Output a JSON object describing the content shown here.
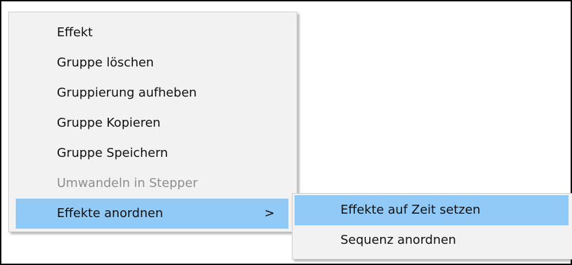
{
  "main_menu": {
    "items": [
      {
        "label": "Effekt",
        "enabled": true
      },
      {
        "label": "Gruppe löschen",
        "enabled": true
      },
      {
        "label": "Gruppierung aufheben",
        "enabled": true
      },
      {
        "label": "Gruppe Kopieren",
        "enabled": true
      },
      {
        "label": "Gruppe Speichern",
        "enabled": true
      },
      {
        "label": "Umwandeln in Stepper",
        "enabled": false
      },
      {
        "label": "Effekte anordnen",
        "enabled": true,
        "highlighted": true,
        "submenu_arrow": ">"
      }
    ]
  },
  "submenu": {
    "items": [
      {
        "label": "Effekte auf Zeit setzen",
        "highlighted": true
      },
      {
        "label": "Sequenz anordnen",
        "highlighted": false
      }
    ]
  },
  "colors": {
    "highlight": "#91c9f7",
    "menu_background": "#f2f2f2",
    "disabled_text": "#8e8e8e",
    "text": "#111111"
  }
}
